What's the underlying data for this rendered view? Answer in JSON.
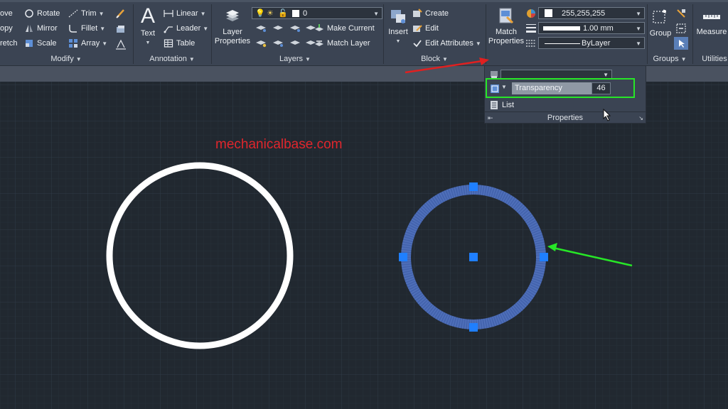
{
  "modify": {
    "items": [
      "ove",
      "Rotate",
      "Trim",
      "opy",
      "Mirror",
      "Fillet",
      "retch",
      "Scale",
      "Array"
    ],
    "footer": "Modify"
  },
  "annotation": {
    "text_label": "Text",
    "linear": "Linear",
    "leader": "Leader",
    "table": "Table",
    "footer": "Annotation"
  },
  "layers": {
    "layer_properties": "Layer\nProperties",
    "layer_properties_l1": "Layer",
    "layer_properties_l2": "Properties",
    "current_layer": "0",
    "make_current": "Make Current",
    "match_layer": "Match Layer",
    "footer": "Layers"
  },
  "block": {
    "insert": "Insert",
    "create": "Create",
    "edit": "Edit",
    "edit_attributes": "Edit Attributes",
    "footer": "Block"
  },
  "properties": {
    "match_l1": "Match",
    "match_l2": "Properties",
    "color_value": "255,255,255",
    "lineweight_value": "1.00 mm",
    "linetype_value": "ByLayer",
    "transparency_label": "Transparency",
    "transparency_value": "46",
    "list_label": "List",
    "footer": "Properties"
  },
  "groups": {
    "group_label": "Group",
    "footer": "Groups"
  },
  "utilities": {
    "measure_label": "Measure",
    "footer": "Utilities"
  },
  "watermark": "mechanicalbase.com",
  "colors": {
    "canvas": "#212830",
    "ribbon": "#3b4453",
    "selection_blue": "#4a6fc4",
    "grip_blue": "#1f7fff",
    "highlight_green": "#27e627",
    "annotation_red": "#e02020",
    "watermark_red": "#e0262c"
  }
}
